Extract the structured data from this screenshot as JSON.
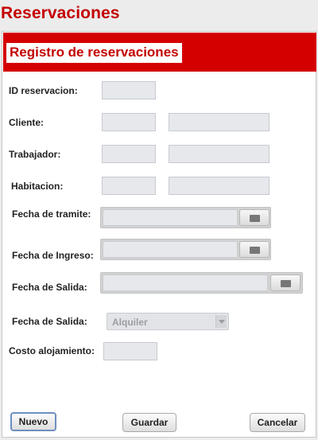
{
  "window": {
    "title": "Reservaciones"
  },
  "panel": {
    "title": "Registro de reservaciones"
  },
  "form": {
    "id_reservacion": {
      "label": "ID reservacion:",
      "value": ""
    },
    "cliente": {
      "label": "Cliente:",
      "id_value": "",
      "name_value": ""
    },
    "trabajador": {
      "label": "Trabajador:",
      "id_value": "",
      "name_value": ""
    },
    "habitacion": {
      "label": "Habitacion:",
      "id_value": "",
      "name_value": ""
    },
    "fecha_tramite": {
      "label": "Fecha de tramite:",
      "value": ""
    },
    "fecha_ingreso": {
      "label": "Fecha de Ingreso:",
      "value": ""
    },
    "fecha_salida": {
      "label": "Fecha de Salida:",
      "value": ""
    },
    "tipo": {
      "label": "Fecha de Salida:",
      "selected": "Alquiler"
    },
    "costo": {
      "label": "Costo alojamiento:",
      "value": ""
    }
  },
  "buttons": {
    "nuevo": "Nuevo",
    "guardar": "Guardar",
    "cancelar": "Cancelar"
  },
  "colors": {
    "accent": "#d40000",
    "title_text": "#c40000"
  },
  "icons": {
    "date_picker": "calendar-icon",
    "dropdown": "chevron-down-icon"
  }
}
